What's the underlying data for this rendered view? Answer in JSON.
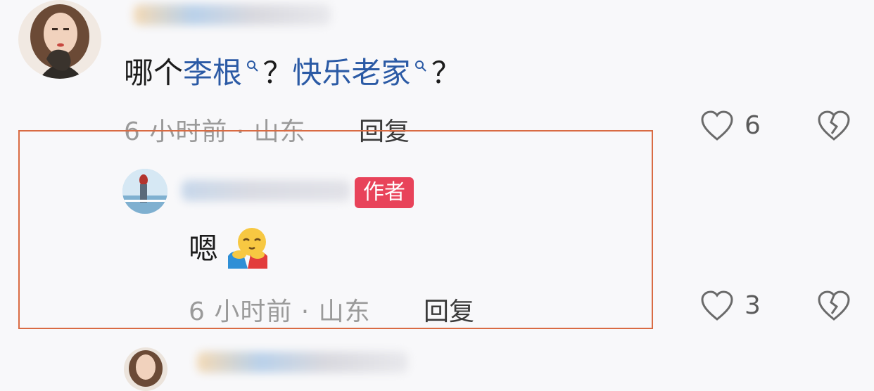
{
  "comment": {
    "text_prefix": "哪个",
    "link1": "李根",
    "sep1": "？",
    "link2": "快乐老家",
    "sep2": "？",
    "meta": "6 小时前 · 山东",
    "reply_label": "回复",
    "like_count": "6"
  },
  "reply": {
    "badge": "作者",
    "text": "嗯",
    "meta": "6 小时前 · 山东",
    "reply_label": "回复",
    "like_count": "3"
  },
  "icons": [
    "search-icon",
    "heart-icon",
    "broken-heart-icon",
    "hug-emoji-icon"
  ],
  "colors": {
    "link": "#2b5aa5",
    "badge": "#e8435a",
    "highlight": "#d96b43"
  }
}
